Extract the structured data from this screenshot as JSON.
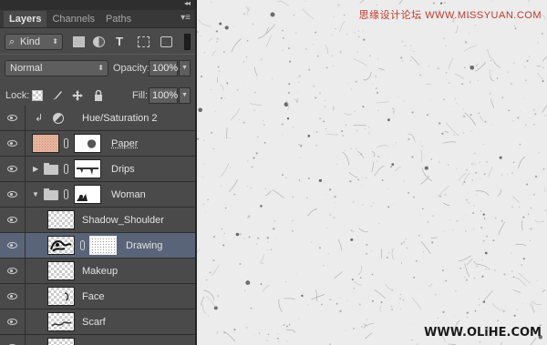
{
  "panel": {
    "tabs": [
      "Layers",
      "Channels",
      "Paths"
    ],
    "filter": {
      "kind_label": "Kind"
    },
    "blend_mode": "Normal",
    "opacity_label": "Opacity:",
    "opacity_value": "100%",
    "lock_label": "Lock:",
    "fill_label": "Fill:",
    "fill_value": "100%"
  },
  "layers": [
    {
      "name": "Hue/Saturation 2"
    },
    {
      "name": "Paper"
    },
    {
      "name": "Drips"
    },
    {
      "name": "Woman"
    },
    {
      "name": "Shadow_Shoulder"
    },
    {
      "name": "Drawing"
    },
    {
      "name": "Makeup"
    },
    {
      "name": "Face"
    },
    {
      "name": "Scarf"
    }
  ],
  "watermarks": {
    "top": "思缘设计论坛 WWW.MISSYUAN.COM",
    "bottom": "WWW.OLiHE.COM"
  },
  "colors": {
    "panel_bg": "#4a4a4a",
    "selected_row": "#5a6478",
    "canvas_bg": "#ececec",
    "watermark_red": "#c0392b"
  }
}
